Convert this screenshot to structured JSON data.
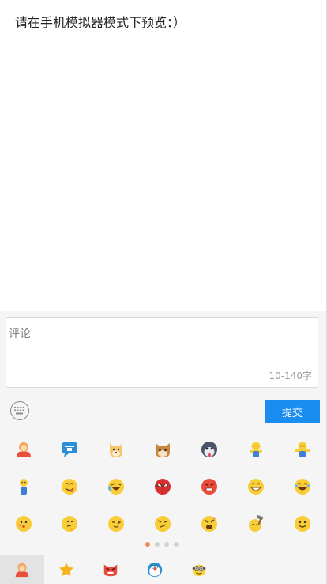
{
  "hint": "请在手机模拟器模式下预览：）",
  "comment": {
    "placeholder": "评论",
    "value": "",
    "counter": "10-140字"
  },
  "toolbar": {
    "keyboard_icon": "keyboard-icon",
    "submit_label": "提交"
  },
  "emoji_page": {
    "rows": [
      [
        "hug-emoji",
        "ad-speech-bubble-emoji",
        "doge-emoji",
        "meow-cat-emoji",
        "husky-emoji",
        "yellow-figure-shrug-emoji",
        "yellow-figure-arms-out-emoji"
      ],
      [
        "standing-figure-emoji",
        "yum-emoji",
        "laugh-cry-emoji",
        "spiderman-emoji",
        "angry-red-emoji",
        "big-grin-emoji",
        "tears-of-joy-emoji"
      ],
      [
        "smile-blush-emoji",
        "thinking-emoji",
        "wink-emoji",
        "smirk-emoji",
        "furious-emoji",
        "hammer-emoji",
        "smile-emoji"
      ]
    ]
  },
  "pager": {
    "total": 4,
    "active": 0
  },
  "tabs": [
    {
      "icon": "hug-tab-icon",
      "selected": true
    },
    {
      "icon": "star-tab-icon",
      "selected": false
    },
    {
      "icon": "cat-tab-icon",
      "selected": false
    },
    {
      "icon": "doraemon-tab-icon",
      "selected": false
    },
    {
      "icon": "minion-tab-icon",
      "selected": false
    }
  ],
  "colors": {
    "accent": "#1a8ef0",
    "pager_active": "#f28a4a",
    "panel_bg": "#f5f5f5"
  }
}
